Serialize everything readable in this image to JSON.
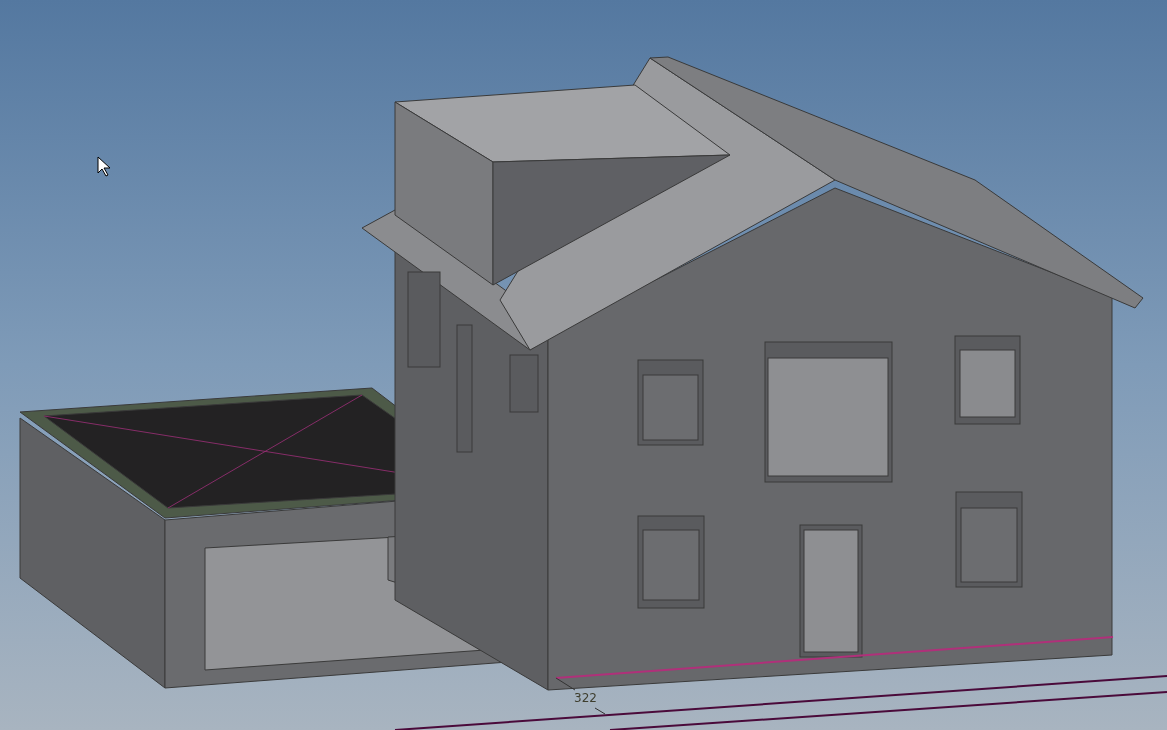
{
  "viewport": {
    "dimension": {
      "label": "322"
    }
  }
}
